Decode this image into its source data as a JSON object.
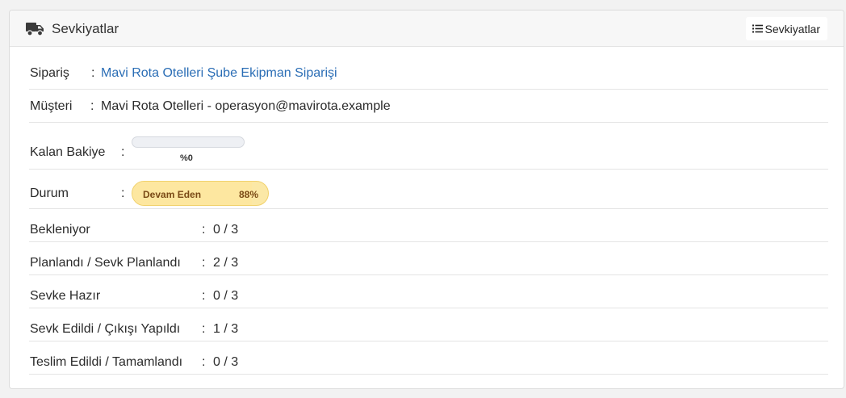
{
  "header": {
    "title": "Sevkiyatlar",
    "button_label": "Sevkiyatlar"
  },
  "order": {
    "label": "Sipariş",
    "separator": ":",
    "value": "Mavi Rota Otelleri Şube Ekipman Siparişi",
    "link_color": "#2a6db5"
  },
  "customer": {
    "label": "Müşteri",
    "separator": ":",
    "value": "Mavi Rota Otelleri - operasyon@mavirota.example"
  },
  "balance": {
    "label": "Kalan Bakiye",
    "separator": ":",
    "progress_percent": 0,
    "percent_text": "%0"
  },
  "status": {
    "label": "Durum",
    "separator": ":",
    "text": "Devam Eden",
    "percent_text": "88%",
    "progress_percent": 88,
    "color": "#fbe8a6"
  },
  "steps": [
    {
      "label": "Bekleniyor",
      "separator": ":",
      "value": "0 / 3"
    },
    {
      "label": "Planlandı / Sevk Planlandı",
      "separator": ":",
      "value": "2 / 3"
    },
    {
      "label": "Sevke Hazır",
      "separator": ":",
      "value": "0 / 3"
    },
    {
      "label": "Sevk Edildi / Çıkışı Yapıldı",
      "separator": ":",
      "value": "1 / 3"
    },
    {
      "label": "Teslim Edildi / Tamamlandı",
      "separator": ":",
      "value": "0 / 3"
    }
  ],
  "icons": {
    "header": "truck-icon",
    "button": "list-icon"
  }
}
